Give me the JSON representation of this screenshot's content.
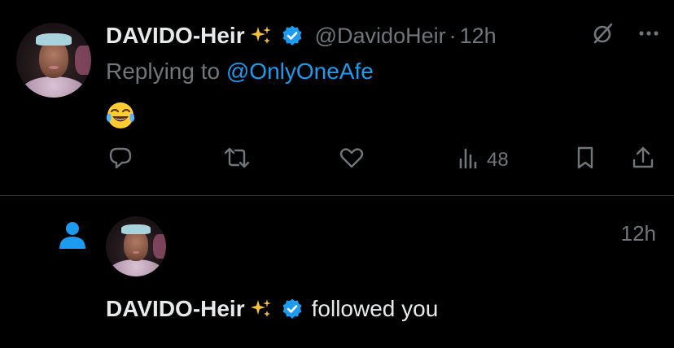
{
  "tweet": {
    "display_name": "DAVIDO-Heir",
    "handle": "@DavidoHeir",
    "separator": "·",
    "time": "12h",
    "replying_prefix": "Replying to ",
    "replying_to": "@OnlyOneAfe",
    "content_emoji": "face-with-tears-of-joy",
    "actions": {
      "views_count": "48"
    }
  },
  "notification": {
    "display_name": "DAVIDO-Heir",
    "action_text": "followed you",
    "time": "12h"
  },
  "icons": {
    "sparkles": "sparkles-icon",
    "verified": "verified-badge-icon",
    "grok": "grok-icon",
    "more": "more-icon",
    "reply": "reply-icon",
    "retweet": "retweet-icon",
    "like": "like-icon",
    "views": "views-icon",
    "bookmark": "bookmark-icon",
    "share": "share-icon",
    "person": "person-icon"
  },
  "colors": {
    "background": "#000000",
    "text": "#e7e9ea",
    "secondary": "#71767b",
    "accent": "#1d9bf0"
  }
}
